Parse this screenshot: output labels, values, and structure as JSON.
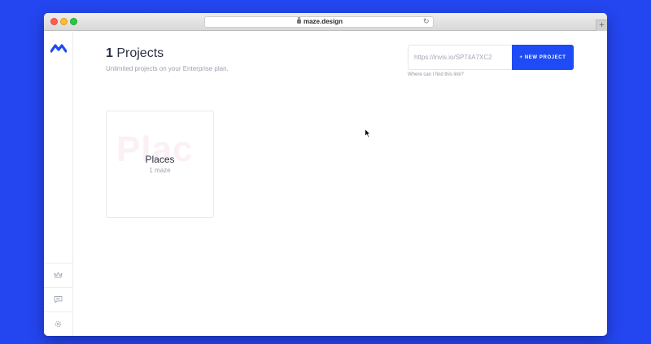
{
  "browser": {
    "url": "maze.design"
  },
  "header": {
    "count": "1",
    "title_word": " Projects",
    "subtitle": "Unlimited projects on your Enterprise plan."
  },
  "import": {
    "link_value": "https://invis.io/SP74A7XC2",
    "new_project_label": "+ NEW PROJECT",
    "help_link": "Where can I find this link?"
  },
  "projects": [
    {
      "name": "Places",
      "count": "1 maze",
      "background_text": "Plac"
    }
  ],
  "sidebar": {
    "icons": [
      "logo-icon",
      "crown-icon",
      "chat-icon",
      "gear-icon"
    ]
  },
  "colors": {
    "background": "#2446f0",
    "accent": "#1e4bf5",
    "title": "#2b3142",
    "muted": "#9ba1b0"
  }
}
